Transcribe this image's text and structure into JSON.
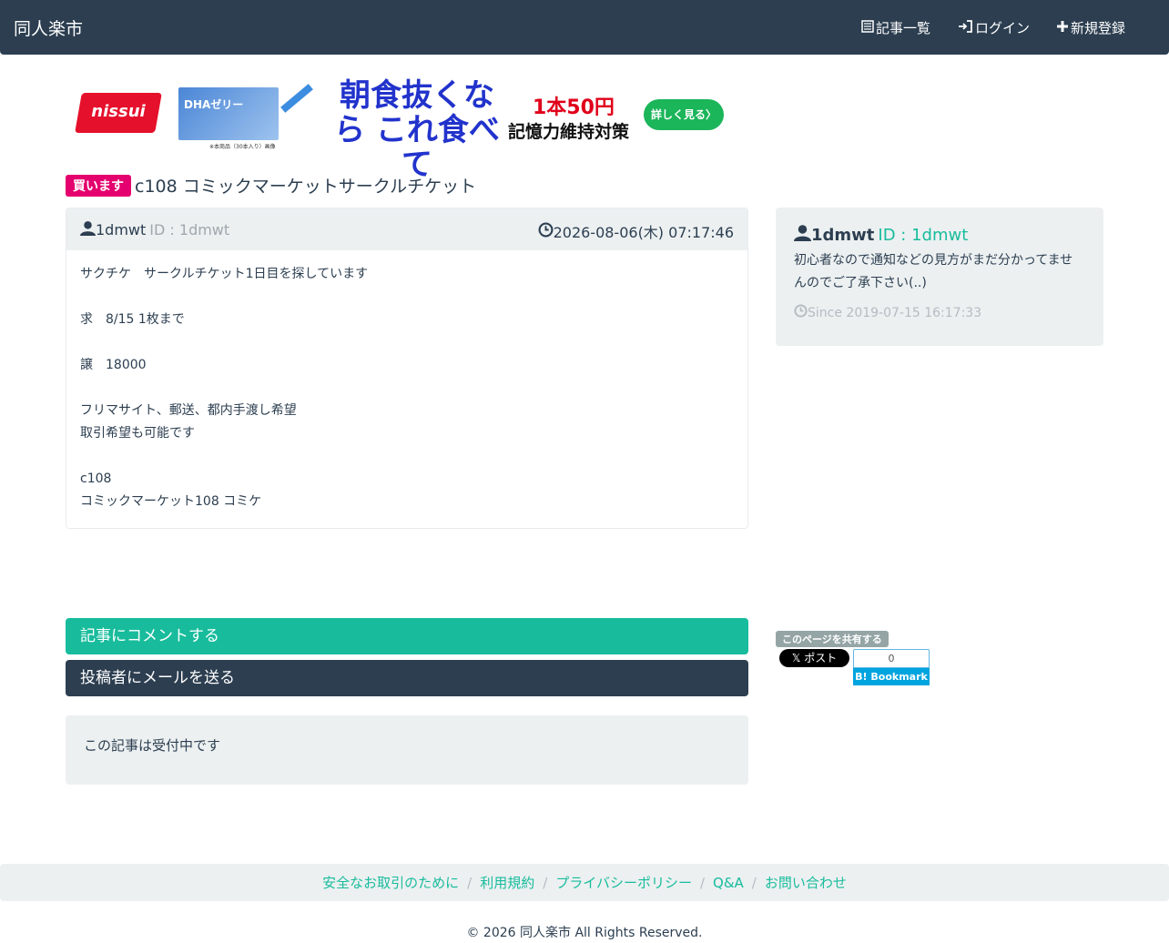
{
  "navbar": {
    "brand": "同人楽市",
    "items": [
      {
        "label": "記事一覧",
        "icon": "list-icon"
      },
      {
        "label": "ログイン",
        "icon": "login-icon"
      },
      {
        "label": "新規登録",
        "icon": "plus-icon"
      }
    ]
  },
  "ad": {
    "logo": "nissui",
    "product_text": "DHAゼリー",
    "caption": "※本商品（30本入り）画像",
    "headline": "朝食抜くなら これ食べて",
    "price": "1本50円",
    "subtitle": "記憶力維持対策",
    "button": "詳しく見る〉"
  },
  "post": {
    "badge": "買います",
    "title": "c108 コミックマーケットサークルチケット",
    "author": "1dmwt",
    "author_id": "ID : 1dmwt",
    "date": "2026-08-06(木) 07:17:46",
    "body": [
      "サクチケ　サークルチケット1日目を探しています",
      "",
      "求　8/15 1枚まで",
      "",
      "譲　18000",
      "",
      "フリマサイト、郵送、都内手渡し希望",
      "取引希望も可能です",
      "",
      "c108",
      "コミックマーケット108 コミケ"
    ]
  },
  "user_card": {
    "name": "1dmwt",
    "id": "ID : 1dmwt",
    "bio": "初心者なので通知などの見方がまだ分かってませんのでご了承下さい(..)",
    "since": "Since 2019-07-15 16:17:33"
  },
  "actions": {
    "comment": "記事にコメントする",
    "mail": "投稿者にメールを送る",
    "status": "この記事は受付中です"
  },
  "share": {
    "label": "このページを共有する",
    "x_post": "𝕏 ポスト",
    "hatena_count": "0",
    "hatena_button": "B! Bookmark"
  },
  "footer": {
    "links": [
      "安全なお取引のために",
      "利用規約",
      "プライバシーポリシー",
      "Q&A",
      "お問い合わせ"
    ],
    "copyright": "© 2026 同人楽市 All Rights Reserved."
  },
  "colors": {
    "navbar": "#2c3e50",
    "accent": "#18bc9c",
    "badge": "#e4006e",
    "panel": "#ecf0f1"
  }
}
